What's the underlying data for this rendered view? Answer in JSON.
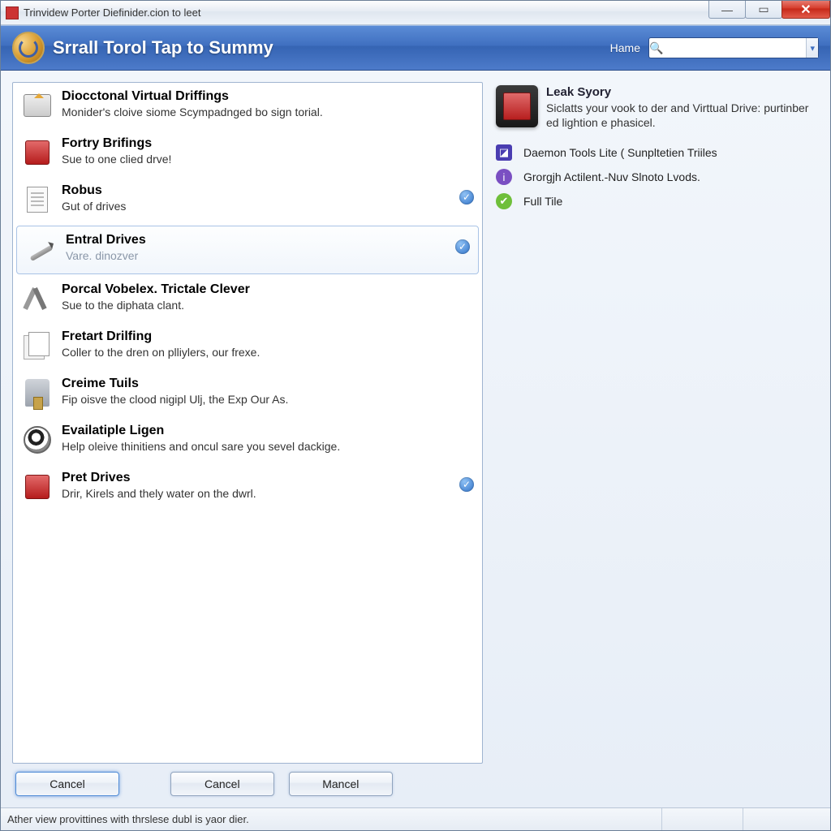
{
  "window": {
    "title": "Trinvidew Porter Diefinider.cion to leet"
  },
  "header": {
    "title": "Srrall Torol Tap to Summy",
    "nav_label": "Hame",
    "search_placeholder": ""
  },
  "items": [
    {
      "title": "Diocctonal Virtual Driffings",
      "desc": "Monider's cloive siome Scympadnged bo sign torial.",
      "icon": "box-arrow",
      "checked": false
    },
    {
      "title": "Fortry Brifings",
      "desc": "Sue to one clied drve!",
      "icon": "red-square",
      "checked": false
    },
    {
      "title": "Robus",
      "desc": "Gut of drives",
      "icon": "document",
      "checked": true
    },
    {
      "title": "Entral Drives",
      "desc": "Vare. dinozver",
      "icon": "pencil",
      "checked": true,
      "selected": true
    },
    {
      "title": "Porcal Vobelex. Trictale Clever",
      "desc": "Sue to the diphata clant.",
      "icon": "tools",
      "checked": false
    },
    {
      "title": "Fretart Drilfing",
      "desc": "Coller to the dren on plliylers, our frexe.",
      "icon": "documents",
      "checked": false
    },
    {
      "title": "Creime Tuils",
      "desc": "Fip oisve the clood nigipl Ulj, the Exp Our As.",
      "icon": "clamp",
      "checked": false
    },
    {
      "title": "Evailatiple Ligen",
      "desc": "Help oleive thinitiens and oncul sare you sevel dackige.",
      "icon": "eye",
      "checked": false
    },
    {
      "title": "Pret Drives",
      "desc": "Drir, Kirels and thely water on the dwrl.",
      "icon": "red-square",
      "checked": true
    }
  ],
  "buttons": {
    "b1": "Cancel",
    "b2": "Cancel",
    "b3": "Mancel"
  },
  "side": {
    "feature_title": "Leak Syory",
    "feature_desc": "Siclatts your vook to der and Virttual Drive: purtinber ed lightion e phasicel.",
    "links": [
      {
        "label": "Daemon Tools Lite ( Sunpltetien Triiles",
        "icon": "purple-square"
      },
      {
        "label": "Grorgjh Actilent.-Nuv Slnoto Lvods.",
        "icon": "info-circle"
      },
      {
        "label": "Full Tile",
        "icon": "green-circle"
      }
    ]
  },
  "status": "Ather view provittines with thrslese dubl is yaor dier."
}
